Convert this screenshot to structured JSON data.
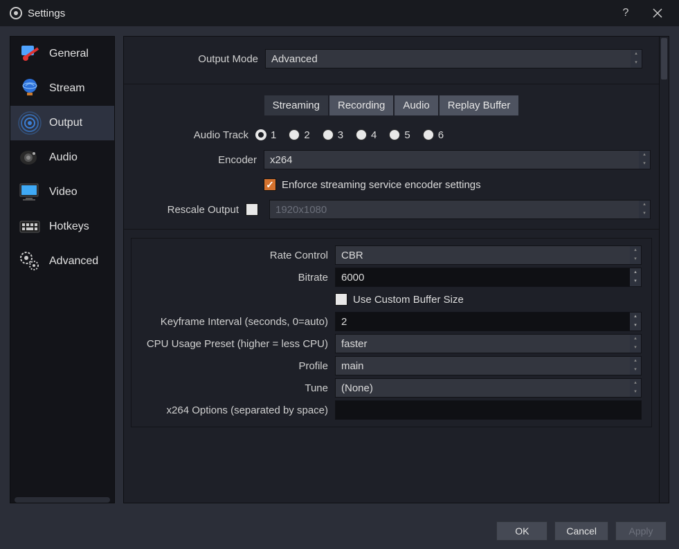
{
  "titlebar": {
    "title": "Settings"
  },
  "sidebar": {
    "items": [
      {
        "label": "General"
      },
      {
        "label": "Stream"
      },
      {
        "label": "Output"
      },
      {
        "label": "Audio"
      },
      {
        "label": "Video"
      },
      {
        "label": "Hotkeys"
      },
      {
        "label": "Advanced"
      }
    ]
  },
  "output_mode": {
    "label": "Output Mode",
    "value": "Advanced"
  },
  "tabs": {
    "streaming": "Streaming",
    "recording": "Recording",
    "audio": "Audio",
    "replay": "Replay Buffer"
  },
  "audio_track": {
    "label": "Audio Track",
    "options": [
      "1",
      "2",
      "3",
      "4",
      "5",
      "6"
    ],
    "selected": "1"
  },
  "encoder": {
    "label": "Encoder",
    "value": "x264"
  },
  "enforce": {
    "label": "Enforce streaming service encoder settings",
    "checked": true
  },
  "rescale": {
    "label": "Rescale Output",
    "checked": false,
    "value": "1920x1080"
  },
  "rate_control": {
    "label": "Rate Control",
    "value": "CBR"
  },
  "bitrate": {
    "label": "Bitrate",
    "value": "6000"
  },
  "custom_buffer": {
    "label": "Use Custom Buffer Size",
    "checked": false
  },
  "keyframe": {
    "label": "Keyframe Interval (seconds, 0=auto)",
    "value": "2"
  },
  "cpu_preset": {
    "label": "CPU Usage Preset (higher = less CPU)",
    "value": "faster"
  },
  "profile": {
    "label": "Profile",
    "value": "main"
  },
  "tune": {
    "label": "Tune",
    "value": "(None)"
  },
  "x264_opts": {
    "label": "x264 Options (separated by space)",
    "value": ""
  },
  "footer": {
    "ok": "OK",
    "cancel": "Cancel",
    "apply": "Apply"
  }
}
